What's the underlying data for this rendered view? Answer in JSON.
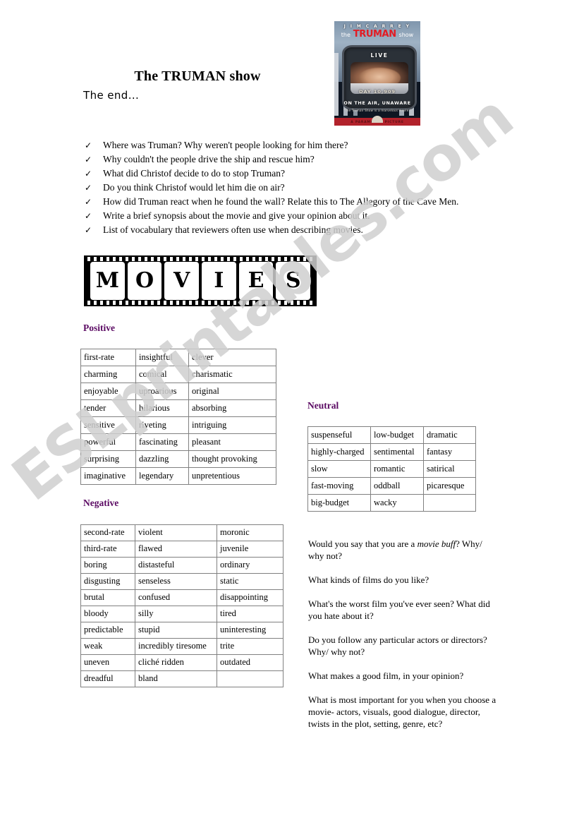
{
  "document": {
    "title": "The TRUMAN show",
    "subtitle": "The end...",
    "watermark": "ESLprintables.com"
  },
  "poster": {
    "billing": "J I M   C A R R E Y",
    "title_the": "the",
    "title_truman": "TRUMAN",
    "title_show": "show",
    "live_label": "LIVE",
    "day_counter": "DAY  10,909",
    "tagline": "ON THE AIR, UNAWARE",
    "quote": "\"The Truman Show is a marvelous movie.\"",
    "bottom_bar": "A PARAMOUNT PICTURE",
    "accent_red": "#e31b23"
  },
  "questions": {
    "bullet_icon": "check-icon",
    "items": [
      "Where was Truman? Why weren't people looking for him there?",
      "Why couldn't the people drive the ship and rescue him?",
      "What did Christof decide to do to stop Truman?",
      "Do you think Christof would let him die on air?",
      "How did Truman react when he found the wall? Relate this to The Allegory of the Cave Men.",
      "Write a brief synopsis about the movie and give your opinion about it.",
      "List of vocabulary that reviewers often use when describing movies."
    ]
  },
  "movies_banner": {
    "letters": [
      "M",
      "O",
      "V",
      "I",
      "E",
      "S"
    ]
  },
  "vocabulary": {
    "heading_color": "#5b0a63",
    "positive": {
      "heading": "Positive",
      "rows": [
        [
          "first-rate",
          "insightful",
          "clever"
        ],
        [
          "charming",
          "comical",
          "charismatic"
        ],
        [
          "enjoyable",
          "uproarious",
          "original"
        ],
        [
          "tender",
          "hilarious",
          "absorbing"
        ],
        [
          "sensitive",
          "riveting",
          "intriguing"
        ],
        [
          "powerful",
          "fascinating",
          "pleasant"
        ],
        [
          "surprising",
          "dazzling",
          "thought provoking"
        ],
        [
          "imaginative",
          "legendary",
          "unpretentious"
        ]
      ]
    },
    "neutral": {
      "heading": "Neutral",
      "rows": [
        [
          "suspenseful",
          "low-budget",
          "dramatic"
        ],
        [
          "highly-charged",
          "sentimental",
          "fantasy"
        ],
        [
          "slow",
          "romantic",
          "satirical"
        ],
        [
          "fast-moving",
          "oddball",
          "picaresque"
        ],
        [
          "big-budget",
          "wacky",
          ""
        ]
      ]
    },
    "negative": {
      "heading": "Negative",
      "rows": [
        [
          "second-rate",
          "violent",
          "moronic"
        ],
        [
          "third-rate",
          "flawed",
          "juvenile"
        ],
        [
          "boring",
          "distasteful",
          "ordinary"
        ],
        [
          "disgusting",
          "senseless",
          "static"
        ],
        [
          "brutal",
          "confused",
          "disappointing"
        ],
        [
          "bloody",
          "silly",
          "tired"
        ],
        [
          "predictable",
          "stupid",
          "uninteresting"
        ],
        [
          "weak",
          "incredibly tiresome",
          "trite"
        ],
        [
          "uneven",
          "cliché ridden",
          "outdated"
        ],
        [
          "dreadful",
          "bland",
          ""
        ]
      ]
    }
  },
  "discussion": {
    "items": [
      {
        "before": "Would you say that you are a ",
        "italic": "movie buff",
        "after": "? Why/ why not?"
      },
      {
        "before": "What kinds of films do you like?",
        "italic": "",
        "after": ""
      },
      {
        "before": "What's the worst film you've ever seen? What did you hate about it?",
        "italic": "",
        "after": ""
      },
      {
        "before": "Do you follow any particular actors or directors? Why/ why not?",
        "italic": "",
        "after": ""
      },
      {
        "before": "What makes a good film, in your opinion?",
        "italic": "",
        "after": ""
      },
      {
        "before": "What is most important for you when you choose a movie- actors, visuals, good dialogue, director, twists in the plot, setting, genre, etc?",
        "italic": "",
        "after": ""
      }
    ]
  }
}
